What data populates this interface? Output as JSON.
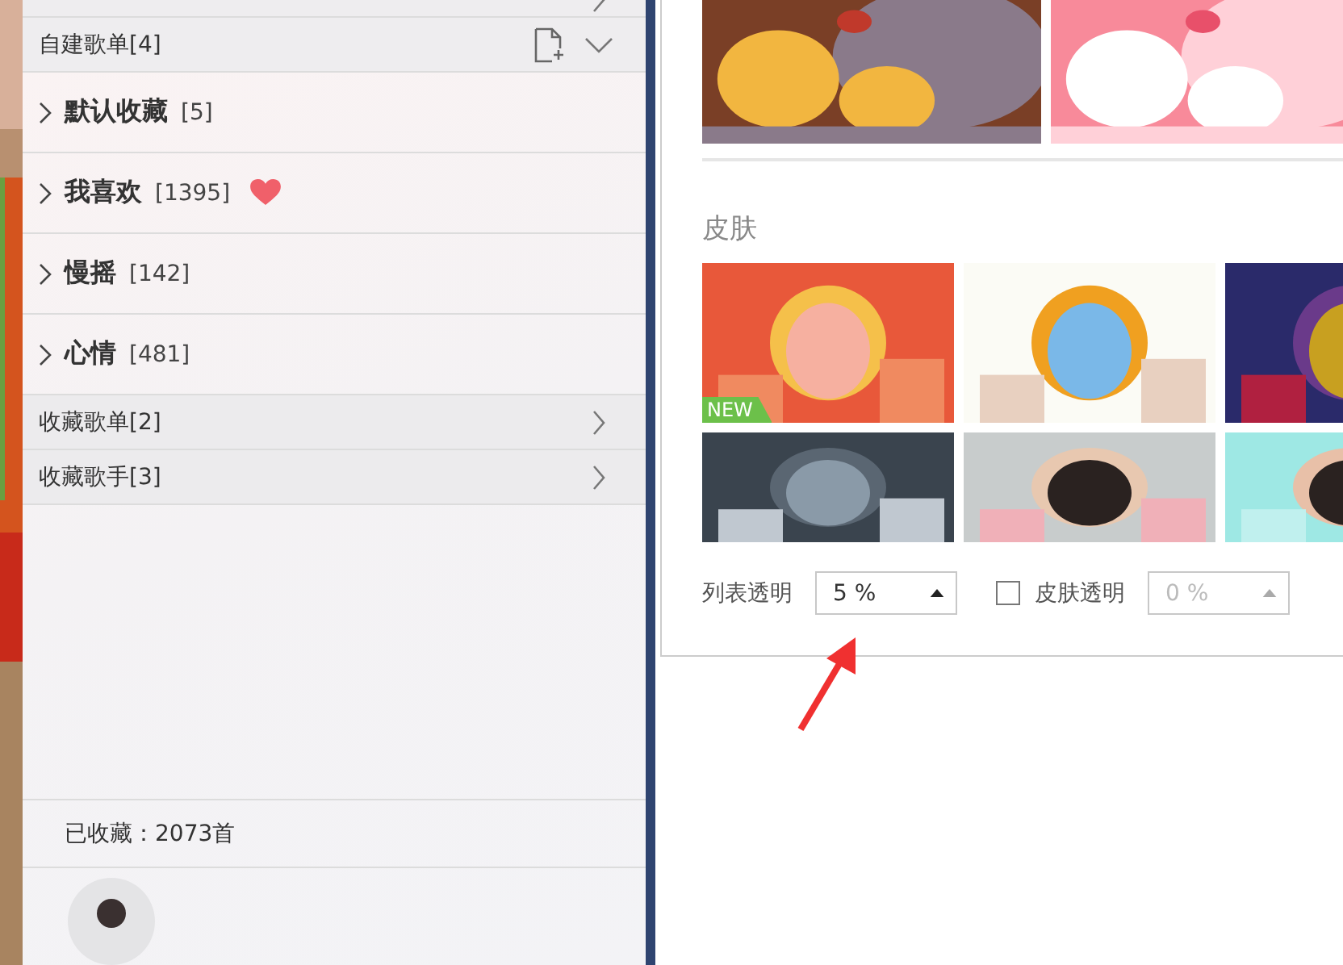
{
  "sidebar": {
    "section_header": {
      "title": "自建歌单[4]"
    },
    "playlists": [
      {
        "name": "默认收藏",
        "count": "[5]",
        "liked": false
      },
      {
        "name": "我喜欢",
        "count": "[1395]",
        "liked": true
      },
      {
        "name": "慢摇",
        "count": "[142]",
        "liked": false
      },
      {
        "name": "心情",
        "count": "[481]",
        "liked": false
      }
    ],
    "links": [
      {
        "label": "收藏歌单[2]"
      },
      {
        "label": "收藏歌手[3]"
      }
    ],
    "footer": {
      "summary": "已收藏：2073首"
    }
  },
  "settings": {
    "themes": [
      {
        "kind": "picture"
      },
      {
        "kind": "picture"
      }
    ],
    "skins_title": "皮肤",
    "skins": [
      {
        "kind": "picture",
        "badge": "NEW"
      },
      {
        "kind": "picture"
      },
      {
        "kind": "picture"
      },
      {
        "kind": "picture"
      },
      {
        "kind": "picture"
      },
      {
        "kind": "picture"
      }
    ],
    "list_opacity": {
      "label": "列表透明",
      "value": "5 %",
      "disabled": false
    },
    "skin_opacity": {
      "label": "皮肤透明",
      "value": "0 %",
      "checked": false,
      "disabled": true
    }
  }
}
